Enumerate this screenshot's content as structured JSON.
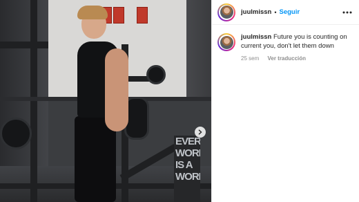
{
  "post": {
    "username": "juulmissn",
    "separator": "•",
    "follow_label": "Seguir",
    "caption": "Future you is counting on current you, don't let them down",
    "time_ago": "25 sem",
    "translate_label": "Ver traducción"
  },
  "media": {
    "banner_text": "EVERY WORKOUT IS A WORKOUT"
  },
  "icons": {
    "more": "more-horizontal-icon",
    "next": "chevron-right-icon"
  },
  "colors": {
    "accent": "#0095f6",
    "text": "#262626",
    "secondary": "#8e8e8e"
  }
}
